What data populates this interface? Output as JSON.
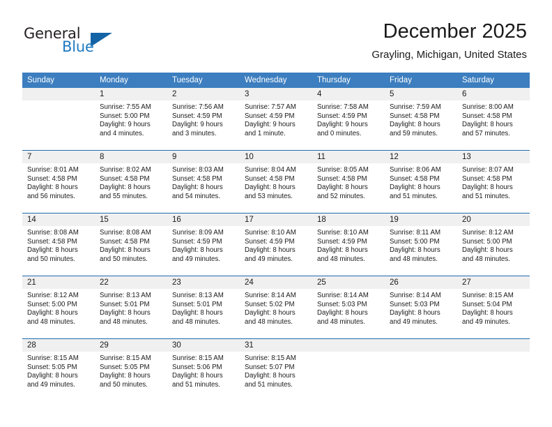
{
  "brand": {
    "name_part1": "General",
    "name_part2": "Blue",
    "logo_icon": "triangle-logo-icon"
  },
  "header": {
    "title": "December 2025",
    "subtitle": "Grayling, Michigan, United States"
  },
  "colors": {
    "header_blue": "#3c7ebf",
    "rule_blue": "#1f6cb0",
    "daynum_band": "#f0f0f0",
    "brand_blue": "#1f7ac0",
    "logo_blue": "#1464a5",
    "text": "#1a1a1a"
  },
  "weekday_headers": [
    "Sunday",
    "Monday",
    "Tuesday",
    "Wednesday",
    "Thursday",
    "Friday",
    "Saturday"
  ],
  "weeks": [
    [
      {
        "day": "",
        "sunrise": "",
        "sunset": "",
        "daylight_line1": "",
        "daylight_line2": "",
        "empty": true
      },
      {
        "day": "1",
        "sunrise": "Sunrise: 7:55 AM",
        "sunset": "Sunset: 5:00 PM",
        "daylight_line1": "Daylight: 9 hours",
        "daylight_line2": "and 4 minutes.",
        "empty": false
      },
      {
        "day": "2",
        "sunrise": "Sunrise: 7:56 AM",
        "sunset": "Sunset: 4:59 PM",
        "daylight_line1": "Daylight: 9 hours",
        "daylight_line2": "and 3 minutes.",
        "empty": false
      },
      {
        "day": "3",
        "sunrise": "Sunrise: 7:57 AM",
        "sunset": "Sunset: 4:59 PM",
        "daylight_line1": "Daylight: 9 hours",
        "daylight_line2": "and 1 minute.",
        "empty": false
      },
      {
        "day": "4",
        "sunrise": "Sunrise: 7:58 AM",
        "sunset": "Sunset: 4:59 PM",
        "daylight_line1": "Daylight: 9 hours",
        "daylight_line2": "and 0 minutes.",
        "empty": false
      },
      {
        "day": "5",
        "sunrise": "Sunrise: 7:59 AM",
        "sunset": "Sunset: 4:58 PM",
        "daylight_line1": "Daylight: 8 hours",
        "daylight_line2": "and 59 minutes.",
        "empty": false
      },
      {
        "day": "6",
        "sunrise": "Sunrise: 8:00 AM",
        "sunset": "Sunset: 4:58 PM",
        "daylight_line1": "Daylight: 8 hours",
        "daylight_line2": "and 57 minutes.",
        "empty": false
      }
    ],
    [
      {
        "day": "7",
        "sunrise": "Sunrise: 8:01 AM",
        "sunset": "Sunset: 4:58 PM",
        "daylight_line1": "Daylight: 8 hours",
        "daylight_line2": "and 56 minutes.",
        "empty": false
      },
      {
        "day": "8",
        "sunrise": "Sunrise: 8:02 AM",
        "sunset": "Sunset: 4:58 PM",
        "daylight_line1": "Daylight: 8 hours",
        "daylight_line2": "and 55 minutes.",
        "empty": false
      },
      {
        "day": "9",
        "sunrise": "Sunrise: 8:03 AM",
        "sunset": "Sunset: 4:58 PM",
        "daylight_line1": "Daylight: 8 hours",
        "daylight_line2": "and 54 minutes.",
        "empty": false
      },
      {
        "day": "10",
        "sunrise": "Sunrise: 8:04 AM",
        "sunset": "Sunset: 4:58 PM",
        "daylight_line1": "Daylight: 8 hours",
        "daylight_line2": "and 53 minutes.",
        "empty": false
      },
      {
        "day": "11",
        "sunrise": "Sunrise: 8:05 AM",
        "sunset": "Sunset: 4:58 PM",
        "daylight_line1": "Daylight: 8 hours",
        "daylight_line2": "and 52 minutes.",
        "empty": false
      },
      {
        "day": "12",
        "sunrise": "Sunrise: 8:06 AM",
        "sunset": "Sunset: 4:58 PM",
        "daylight_line1": "Daylight: 8 hours",
        "daylight_line2": "and 51 minutes.",
        "empty": false
      },
      {
        "day": "13",
        "sunrise": "Sunrise: 8:07 AM",
        "sunset": "Sunset: 4:58 PM",
        "daylight_line1": "Daylight: 8 hours",
        "daylight_line2": "and 51 minutes.",
        "empty": false
      }
    ],
    [
      {
        "day": "14",
        "sunrise": "Sunrise: 8:08 AM",
        "sunset": "Sunset: 4:58 PM",
        "daylight_line1": "Daylight: 8 hours",
        "daylight_line2": "and 50 minutes.",
        "empty": false
      },
      {
        "day": "15",
        "sunrise": "Sunrise: 8:08 AM",
        "sunset": "Sunset: 4:58 PM",
        "daylight_line1": "Daylight: 8 hours",
        "daylight_line2": "and 50 minutes.",
        "empty": false
      },
      {
        "day": "16",
        "sunrise": "Sunrise: 8:09 AM",
        "sunset": "Sunset: 4:59 PM",
        "daylight_line1": "Daylight: 8 hours",
        "daylight_line2": "and 49 minutes.",
        "empty": false
      },
      {
        "day": "17",
        "sunrise": "Sunrise: 8:10 AM",
        "sunset": "Sunset: 4:59 PM",
        "daylight_line1": "Daylight: 8 hours",
        "daylight_line2": "and 49 minutes.",
        "empty": false
      },
      {
        "day": "18",
        "sunrise": "Sunrise: 8:10 AM",
        "sunset": "Sunset: 4:59 PM",
        "daylight_line1": "Daylight: 8 hours",
        "daylight_line2": "and 48 minutes.",
        "empty": false
      },
      {
        "day": "19",
        "sunrise": "Sunrise: 8:11 AM",
        "sunset": "Sunset: 5:00 PM",
        "daylight_line1": "Daylight: 8 hours",
        "daylight_line2": "and 48 minutes.",
        "empty": false
      },
      {
        "day": "20",
        "sunrise": "Sunrise: 8:12 AM",
        "sunset": "Sunset: 5:00 PM",
        "daylight_line1": "Daylight: 8 hours",
        "daylight_line2": "and 48 minutes.",
        "empty": false
      }
    ],
    [
      {
        "day": "21",
        "sunrise": "Sunrise: 8:12 AM",
        "sunset": "Sunset: 5:00 PM",
        "daylight_line1": "Daylight: 8 hours",
        "daylight_line2": "and 48 minutes.",
        "empty": false
      },
      {
        "day": "22",
        "sunrise": "Sunrise: 8:13 AM",
        "sunset": "Sunset: 5:01 PM",
        "daylight_line1": "Daylight: 8 hours",
        "daylight_line2": "and 48 minutes.",
        "empty": false
      },
      {
        "day": "23",
        "sunrise": "Sunrise: 8:13 AM",
        "sunset": "Sunset: 5:01 PM",
        "daylight_line1": "Daylight: 8 hours",
        "daylight_line2": "and 48 minutes.",
        "empty": false
      },
      {
        "day": "24",
        "sunrise": "Sunrise: 8:14 AM",
        "sunset": "Sunset: 5:02 PM",
        "daylight_line1": "Daylight: 8 hours",
        "daylight_line2": "and 48 minutes.",
        "empty": false
      },
      {
        "day": "25",
        "sunrise": "Sunrise: 8:14 AM",
        "sunset": "Sunset: 5:03 PM",
        "daylight_line1": "Daylight: 8 hours",
        "daylight_line2": "and 48 minutes.",
        "empty": false
      },
      {
        "day": "26",
        "sunrise": "Sunrise: 8:14 AM",
        "sunset": "Sunset: 5:03 PM",
        "daylight_line1": "Daylight: 8 hours",
        "daylight_line2": "and 49 minutes.",
        "empty": false
      },
      {
        "day": "27",
        "sunrise": "Sunrise: 8:15 AM",
        "sunset": "Sunset: 5:04 PM",
        "daylight_line1": "Daylight: 8 hours",
        "daylight_line2": "and 49 minutes.",
        "empty": false
      }
    ],
    [
      {
        "day": "28",
        "sunrise": "Sunrise: 8:15 AM",
        "sunset": "Sunset: 5:05 PM",
        "daylight_line1": "Daylight: 8 hours",
        "daylight_line2": "and 49 minutes.",
        "empty": false
      },
      {
        "day": "29",
        "sunrise": "Sunrise: 8:15 AM",
        "sunset": "Sunset: 5:05 PM",
        "daylight_line1": "Daylight: 8 hours",
        "daylight_line2": "and 50 minutes.",
        "empty": false
      },
      {
        "day": "30",
        "sunrise": "Sunrise: 8:15 AM",
        "sunset": "Sunset: 5:06 PM",
        "daylight_line1": "Daylight: 8 hours",
        "daylight_line2": "and 51 minutes.",
        "empty": false
      },
      {
        "day": "31",
        "sunrise": "Sunrise: 8:15 AM",
        "sunset": "Sunset: 5:07 PM",
        "daylight_line1": "Daylight: 8 hours",
        "daylight_line2": "and 51 minutes.",
        "empty": false
      },
      {
        "day": "",
        "sunrise": "",
        "sunset": "",
        "daylight_line1": "",
        "daylight_line2": "",
        "empty": true
      },
      {
        "day": "",
        "sunrise": "",
        "sunset": "",
        "daylight_line1": "",
        "daylight_line2": "",
        "empty": true
      },
      {
        "day": "",
        "sunrise": "",
        "sunset": "",
        "daylight_line1": "",
        "daylight_line2": "",
        "empty": true
      }
    ]
  ]
}
